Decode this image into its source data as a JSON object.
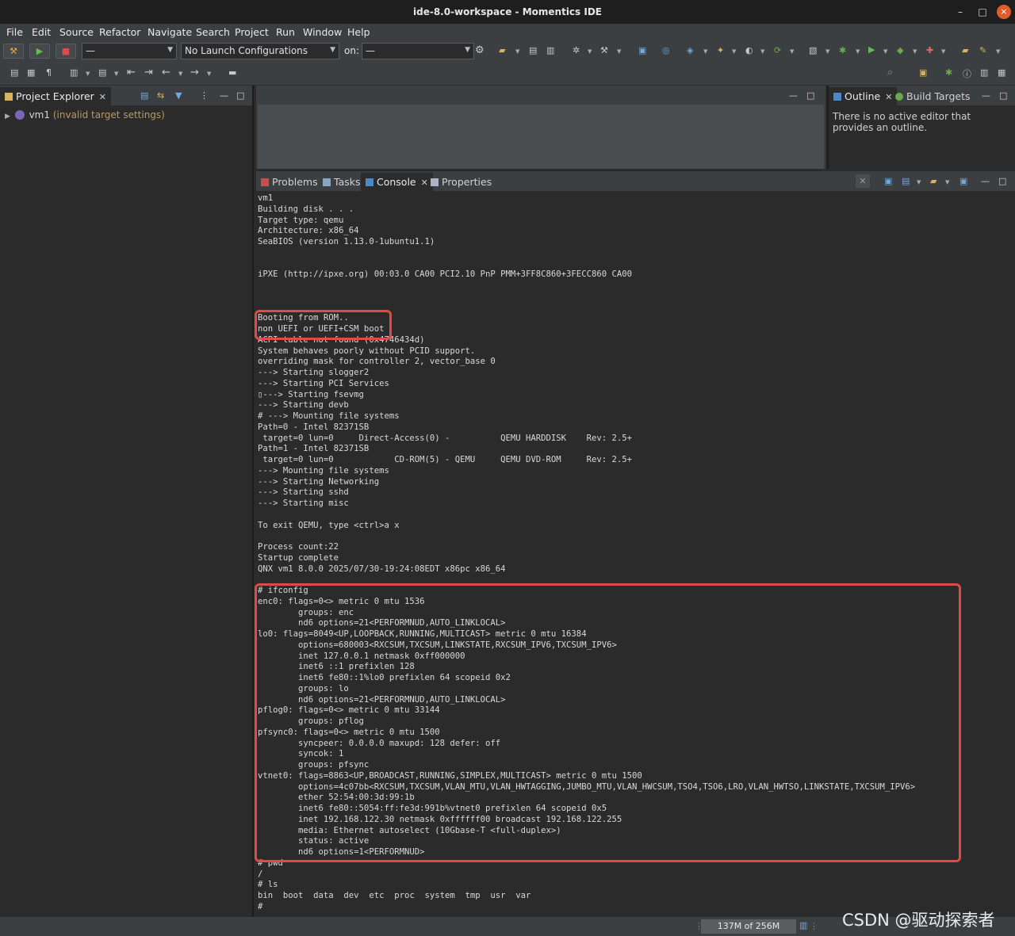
{
  "window": {
    "title": "ide-8.0-workspace - Momentics IDE",
    "minimize_glyph": "–",
    "maximize_glyph": "□",
    "close_glyph": "×"
  },
  "menu": [
    "File",
    "Edit",
    "Source",
    "Refactor",
    "Navigate",
    "Search",
    "Project",
    "Run",
    "Window",
    "Help"
  ],
  "toolbar": {
    "launch_mode": "—",
    "launch_config": "No Launch Configurations",
    "on_label": "on:",
    "target": "—"
  },
  "project_explorer": {
    "tab_label": "Project Explorer",
    "tree": [
      {
        "name": "vm1",
        "note": "(invalid target settings)"
      }
    ]
  },
  "outline": {
    "tab_label": "Outline",
    "build_targets_label": "Build Targets",
    "message": "There is no active editor that provides an outline."
  },
  "bottom_tabs": {
    "problems": "Problems",
    "tasks": "Tasks",
    "console": "Console",
    "properties": "Properties"
  },
  "console": {
    "lines": [
      "vm1",
      "Building disk . . .",
      "Target type: qemu",
      "Architecture: x86_64",
      "SeaBIOS (version 1.13.0-1ubuntu1.1)",
      "",
      "",
      "iPXE (http://ipxe.org) 00:03.0 CA00 PCI2.10 PnP PMM+3FF8C860+3FECC860 CA00",
      "",
      "",
      "",
      "Booting from ROM..",
      "non UEFI or UEFI+CSM boot",
      "ACPI table not found (0x4746434d)",
      "System behaves poorly without PCID support.",
      "overriding mask for controller 2, vector_base 0",
      "---> Starting slogger2",
      "---> Starting PCI Services",
      "▯---> Starting fsevmg",
      "---> Starting devb",
      "# ---> Mounting file systems",
      "Path=0 - Intel 82371SB",
      " target=0 lun=0     Direct-Access(0) -          QEMU HARDDISK    Rev: 2.5+",
      "Path=1 - Intel 82371SB",
      " target=0 lun=0            CD-ROM(5) - QEMU     QEMU DVD-ROM     Rev: 2.5+",
      "---> Mounting file systems",
      "---> Starting Networking",
      "---> Starting sshd",
      "---> Starting misc",
      "",
      "To exit QEMU, type <ctrl>a x",
      "",
      "Process count:22",
      "Startup complete",
      "QNX vm1 8.0.0 2025/07/30-19:24:08EDT x86pc x86_64",
      "",
      "# ifconfig",
      "enc0: flags=0<> metric 0 mtu 1536",
      "        groups: enc",
      "        nd6 options=21<PERFORMNUD,AUTO_LINKLOCAL>",
      "lo0: flags=8049<UP,LOOPBACK,RUNNING,MULTICAST> metric 0 mtu 16384",
      "        options=680003<RXCSUM,TXCSUM,LINKSTATE,RXCSUM_IPV6,TXCSUM_IPV6>",
      "        inet 127.0.0.1 netmask 0xff000000",
      "        inet6 ::1 prefixlen 128",
      "        inet6 fe80::1%lo0 prefixlen 64 scopeid 0x2",
      "        groups: lo",
      "        nd6 options=21<PERFORMNUD,AUTO_LINKLOCAL>",
      "pflog0: flags=0<> metric 0 mtu 33144",
      "        groups: pflog",
      "pfsync0: flags=0<> metric 0 mtu 1500",
      "        syncpeer: 0.0.0.0 maxupd: 128 defer: off",
      "        syncok: 1",
      "        groups: pfsync",
      "vtnet0: flags=8863<UP,BROADCAST,RUNNING,SIMPLEX,MULTICAST> metric 0 mtu 1500",
      "        options=4c07bb<RXCSUM,TXCSUM,VLAN_MTU,VLAN_HWTAGGING,JUMBO_MTU,VLAN_HWCSUM,TSO4,TSO6,LRO,VLAN_HWTSO,LINKSTATE,TXCSUM_IPV6>",
      "        ether 52:54:00:3d:99:1b",
      "        inet6 fe80::5054:ff:fe3d:991b%vtnet0 prefixlen 64 scopeid 0x5",
      "        inet 192.168.122.30 netmask 0xffffff00 broadcast 192.168.122.255",
      "        media: Ethernet autoselect (10Gbase-T <full-duplex>)",
      "        status: active",
      "        nd6 options=1<PERFORMNUD>",
      "# pwd",
      "/",
      "# ls",
      "bin  boot  data  dev  etc  proc  system  tmp  usr  var",
      "#"
    ]
  },
  "status_bar": {
    "heap": "137M of 256M"
  },
  "watermark": "CSDN @驱动探索者",
  "colors": {
    "highlight_box": "#e24a4a",
    "invalid_note": "#b99a62",
    "background": "#2b2b2b"
  }
}
